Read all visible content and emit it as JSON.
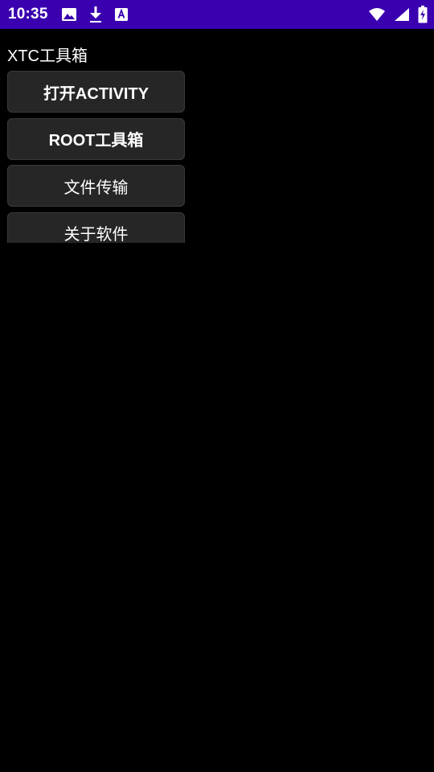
{
  "status_bar": {
    "time": "10:35",
    "left_icons": [
      "image-icon",
      "download-icon",
      "font-a-icon"
    ],
    "right_icons": [
      "wifi-icon",
      "signal-icon",
      "battery-charging-icon"
    ],
    "background": "#3a00b0"
  },
  "app": {
    "title": "XTC工具箱"
  },
  "buttons": [
    {
      "label": "打开ACTIVITY"
    },
    {
      "label": "ROOT工具箱"
    },
    {
      "label": "文件传输"
    },
    {
      "label": "关于软件"
    }
  ],
  "colors": {
    "background": "#000000",
    "button_bg": "#262626",
    "text": "#ffffff"
  }
}
